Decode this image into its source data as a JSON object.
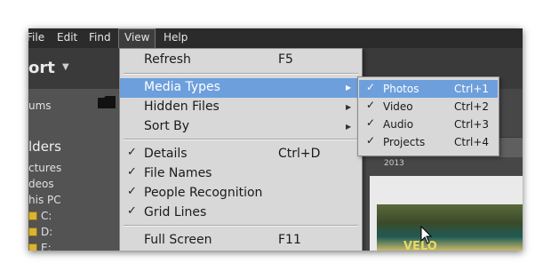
{
  "menubar": {
    "items": [
      {
        "label": "File"
      },
      {
        "label": "Edit"
      },
      {
        "label": "Find"
      },
      {
        "label": "View"
      },
      {
        "label": "Help"
      }
    ]
  },
  "toolbar": {
    "sort_label": "ort",
    "sort_caret": "▼"
  },
  "left_panel": {
    "albums_label": "ums",
    "folders_heading": "lders",
    "tree": [
      {
        "label": "ctures"
      },
      {
        "label": "deos"
      },
      {
        "label": "his PC"
      },
      {
        "label": "C:"
      },
      {
        "label": "D:"
      },
      {
        "label": "E:"
      }
    ]
  },
  "view_menu": {
    "items": [
      {
        "label": "Refresh",
        "shortcut": "F5"
      },
      {
        "label": "Media Types",
        "submenu_arrow": "▶"
      },
      {
        "label": "Hidden Files",
        "submenu_arrow": "▶"
      },
      {
        "label": "Sort By",
        "submenu_arrow": "▶"
      },
      {
        "label": "Details",
        "shortcut": "Ctrl+D",
        "check": "✓"
      },
      {
        "label": "File Names",
        "check": "✓"
      },
      {
        "label": "People Recognition",
        "check": "✓"
      },
      {
        "label": "Grid Lines",
        "check": "✓"
      },
      {
        "label": "Full Screen",
        "shortcut": "F11"
      }
    ]
  },
  "media_types_submenu": {
    "items": [
      {
        "label": "Photos",
        "shortcut": "Ctrl+1",
        "check": "✓"
      },
      {
        "label": "Video",
        "shortcut": "Ctrl+2",
        "check": "✓"
      },
      {
        "label": "Audio",
        "shortcut": "Ctrl+3",
        "check": "✓"
      },
      {
        "label": "Projects",
        "shortcut": "Ctrl+4",
        "check": "✓"
      }
    ]
  },
  "content": {
    "timeline_year": "2013",
    "photo_text": "VELO"
  },
  "colors": {
    "menu_highlight": "#6d9fdc",
    "menubar_bg": "#2b2b2b",
    "menu_bg": "#d8d8d8"
  }
}
